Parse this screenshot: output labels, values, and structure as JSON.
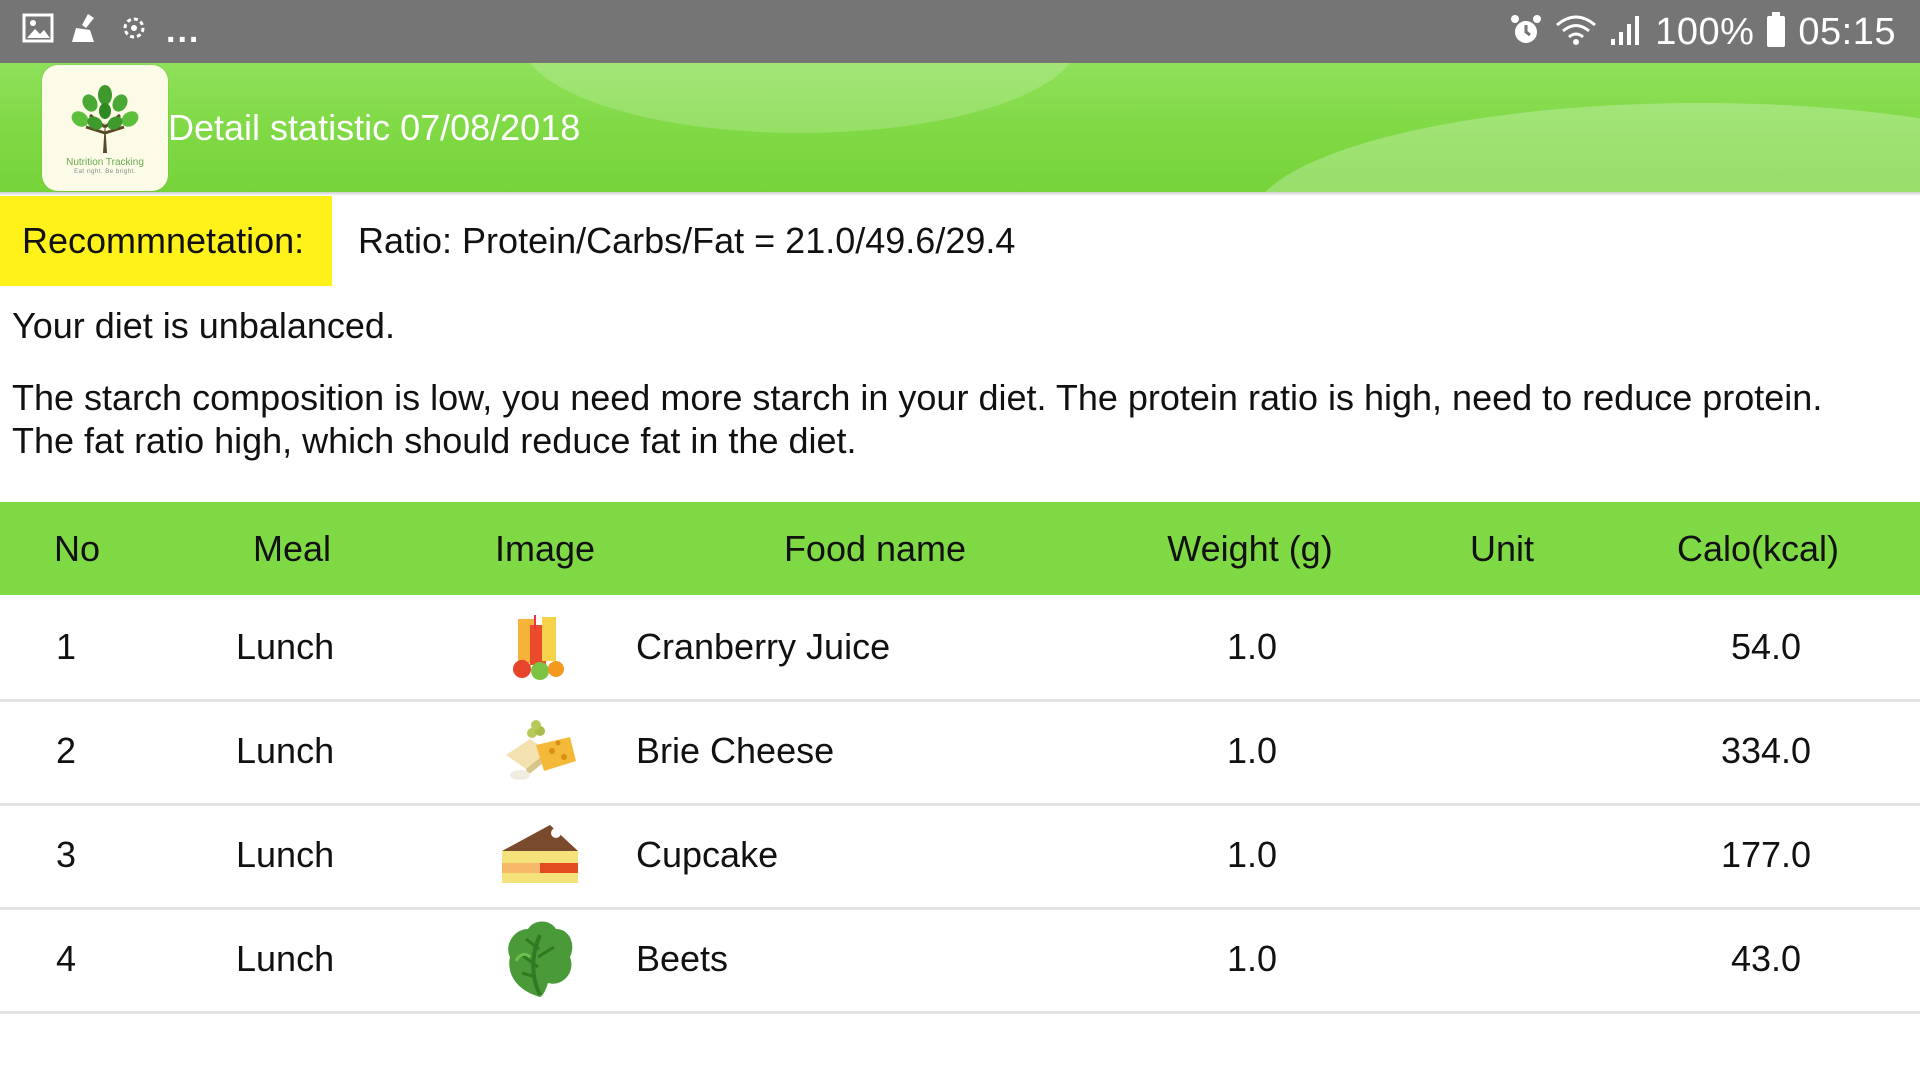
{
  "status_bar": {
    "battery": "100%",
    "time": "05:15",
    "overflow": "...",
    "left_icons": [
      "gallery-icon",
      "cleaner-icon",
      "sync-icon"
    ],
    "right_icons": [
      "alarm-icon",
      "wifi-icon",
      "signal-icon",
      "battery-icon"
    ]
  },
  "header": {
    "title": "Detail statistic 07/08/2018",
    "logo_text": "Nutrition Tracking",
    "logo_subtext": "Eat right. Be bright.",
    "color": "#7fd944"
  },
  "recommendation": {
    "label": "Recommnetation:",
    "ratio": "Ratio: Protein/Carbs/Fat = 21.0/49.6/29.4",
    "verdict": "Your diet is unbalanced.",
    "advice_line1": "The starch composition is low, you need more starch in your diet. The protein ratio is high, need to reduce protein.",
    "advice_line2": "The fat ratio high, which should reduce fat in the diet.",
    "label_color": "#fff21a"
  },
  "table": {
    "headers": {
      "no": "No",
      "meal": "Meal",
      "image": "Image",
      "food": "Food name",
      "weight": "Weight (g)",
      "unit": "Unit",
      "calo": "Calo(kcal)"
    },
    "rows": [
      {
        "no": "1",
        "meal": "Lunch",
        "image": "juice-icon",
        "food": "Cranberry Juice",
        "weight": "1.0",
        "unit": "",
        "calo": "54.0"
      },
      {
        "no": "2",
        "meal": "Lunch",
        "image": "cheese-icon",
        "food": "Brie Cheese",
        "weight": "1.0",
        "unit": "",
        "calo": "334.0"
      },
      {
        "no": "3",
        "meal": "Lunch",
        "image": "cake-icon",
        "food": "Cupcake",
        "weight": "1.0",
        "unit": "",
        "calo": "177.0"
      },
      {
        "no": "4",
        "meal": "Lunch",
        "image": "lettuce-icon",
        "food": "Beets",
        "weight": "1.0",
        "unit": "",
        "calo": "43.0"
      }
    ]
  }
}
